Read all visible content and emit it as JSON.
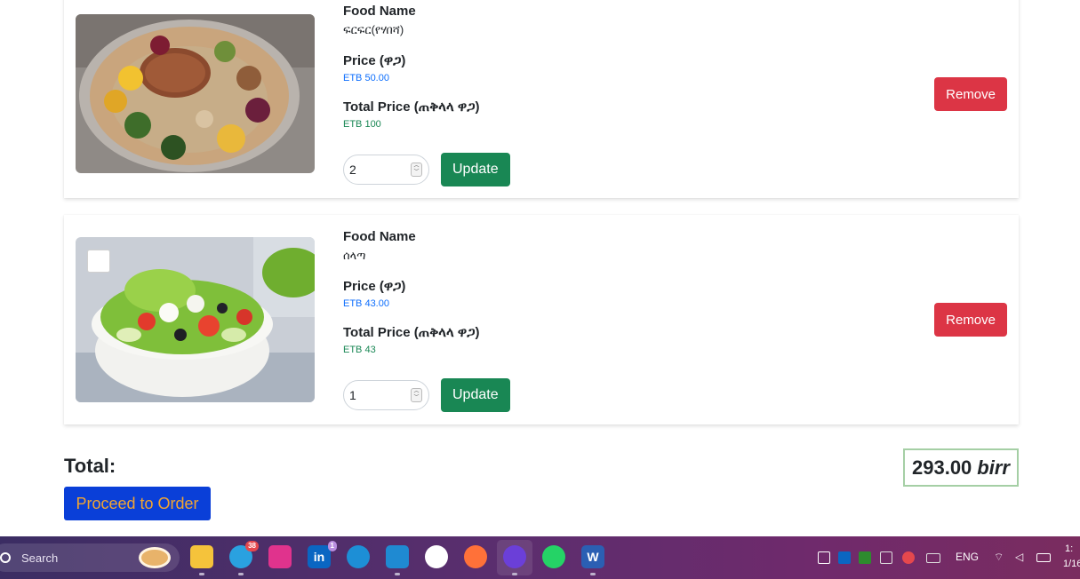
{
  "cart_items": [
    {
      "food_name_label": "Food Name",
      "food_name": "ፍርፍር(የሃበሻ)",
      "price_label": "Price (ዋጋ)",
      "price": "ETB 50.00",
      "total_price_label": "Total Price (ጠቅላላ ዋጋ)",
      "total_price": "ETB 100",
      "quantity": "2",
      "update_label": "Update",
      "remove_label": "Remove"
    },
    {
      "food_name_label": "Food Name",
      "food_name": "ሰላጣ",
      "price_label": "Price (ዋጋ)",
      "price": "ETB 43.00",
      "total_price_label": "Total Price (ጠቅላላ ዋጋ)",
      "total_price": "ETB 43",
      "quantity": "1",
      "update_label": "Update",
      "remove_label": "Remove"
    }
  ],
  "summary": {
    "total_label": "Total:",
    "total_amount": "293.00",
    "total_unit": "birr",
    "proceed_label": "Proceed to Order"
  },
  "taskbar": {
    "search_label": "Search",
    "telegram_badge": "38",
    "linkedin_badge": "1",
    "language": "ENG",
    "clock_time": "1:",
    "clock_date": "1/16"
  },
  "colors": {
    "remove": "#dc3545",
    "update": "#198754",
    "price": "#0d6efd",
    "total_price": "#198754",
    "proceed_bg": "#0a3fd8",
    "proceed_text": "#f2a531"
  }
}
